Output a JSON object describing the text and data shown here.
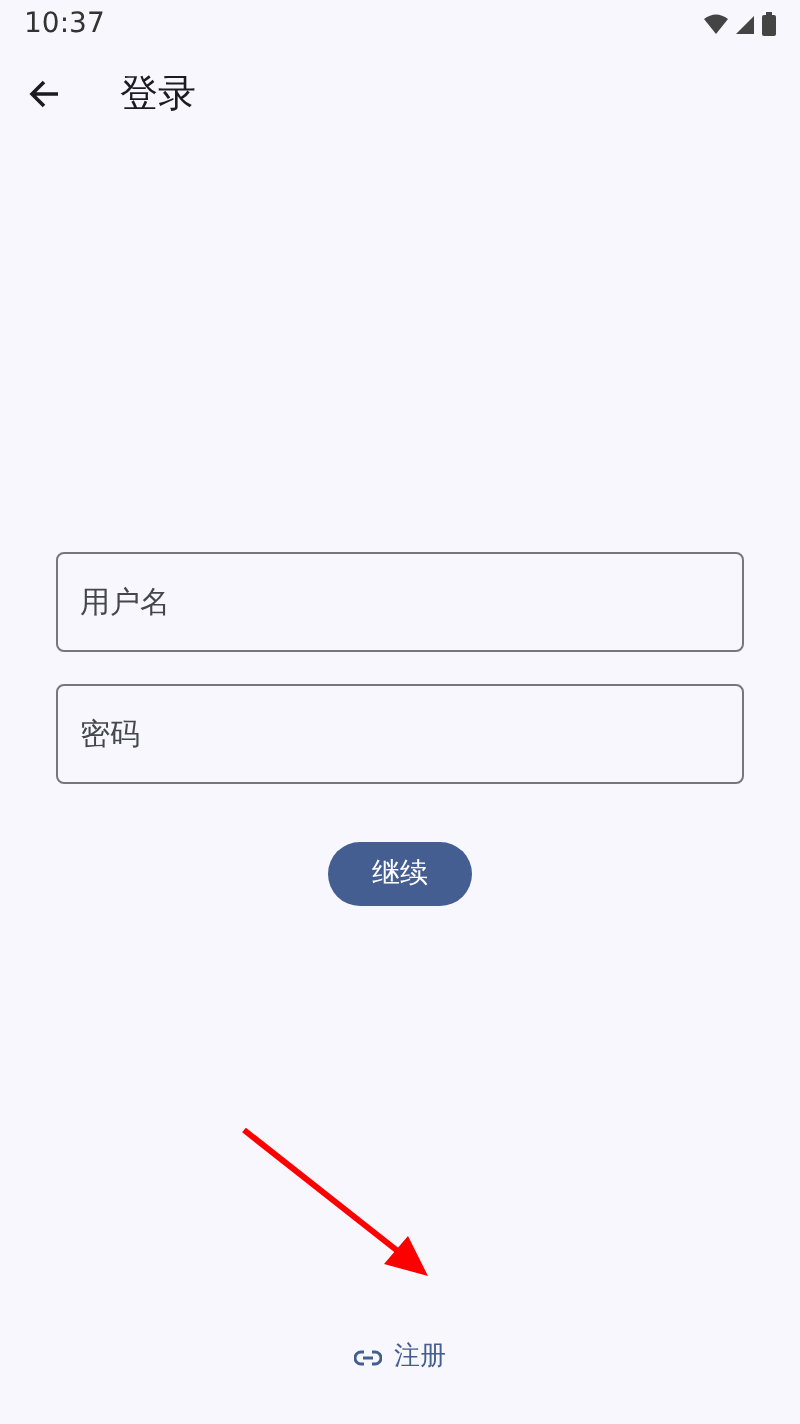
{
  "status_bar": {
    "time": "10:37"
  },
  "app_bar": {
    "title": "登录"
  },
  "fields": [
    {
      "placeholder": "用户名"
    },
    {
      "placeholder": "密码"
    }
  ],
  "continue_button": {
    "label": "继续"
  },
  "register_link": {
    "label": "注册"
  },
  "annotation": {
    "kind": "arrow",
    "color": "#ff0000"
  }
}
